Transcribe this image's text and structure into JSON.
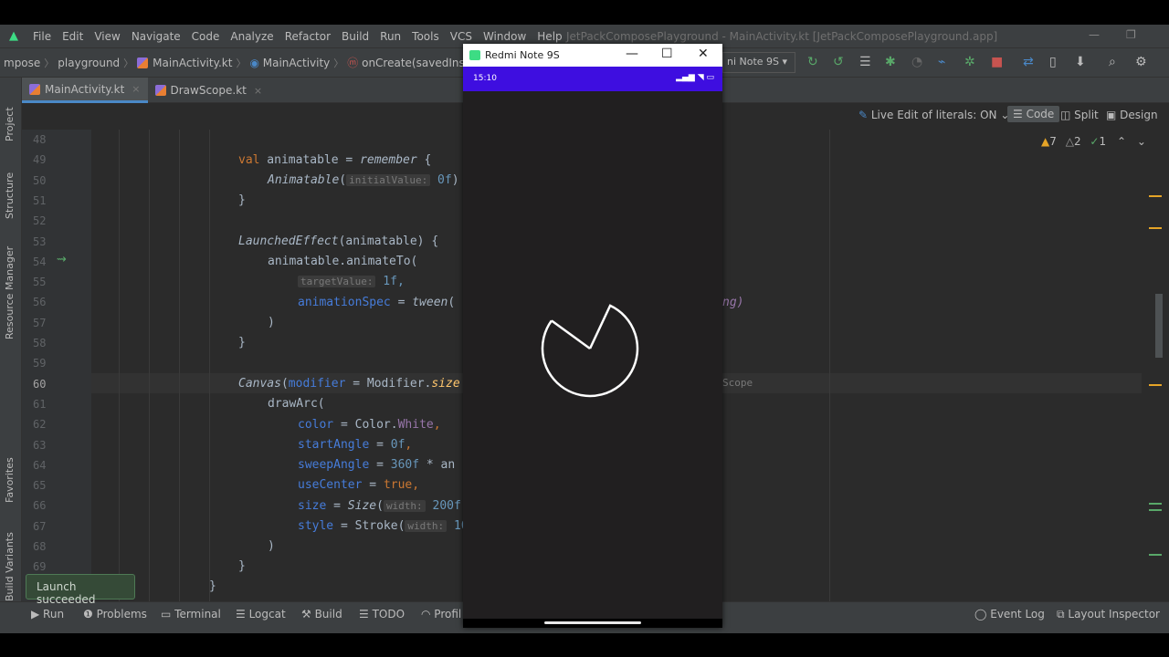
{
  "menu": {
    "items": [
      "File",
      "Edit",
      "View",
      "Navigate",
      "Code",
      "Analyze",
      "Refactor",
      "Build",
      "Run",
      "Tools",
      "VCS",
      "Window",
      "Help"
    ],
    "window_title": "JetPackComposePlayground - MainActivity.kt [JetPackComposePlayground.app]"
  },
  "breadcrumb": [
    "mpose",
    "playground",
    "MainActivity.kt",
    "MainActivity",
    "onCreate(savedInstanceState:"
  ],
  "device_selector": "ni Note 9S",
  "tabs": [
    {
      "label": "MainActivity.kt",
      "close": "×"
    },
    {
      "label": "DrawScope.kt",
      "close": "×"
    }
  ],
  "left_panels": [
    "Project",
    "Structure",
    "Resource Manager",
    "Favorites",
    "Build Variants"
  ],
  "editor_toolbar": {
    "live_edit": "Live Edit of literals: ON",
    "code": "Code",
    "split": "Split",
    "design": "Design"
  },
  "inspections": {
    "warnings": "7",
    "weak_warnings": "2",
    "ok": "1"
  },
  "line_numbers": [
    "48",
    "49",
    "50",
    "51",
    "52",
    "53",
    "54",
    "55",
    "56",
    "57",
    "58",
    "59",
    "60",
    "61",
    "62",
    "63",
    "64",
    "65",
    "66",
    "67",
    "68",
    "69"
  ],
  "current_line": "60",
  "code": {
    "l49": {
      "kw": "val",
      "name": " animatable",
      "eq": " = ",
      "fn": "remember",
      "rest": " {"
    },
    "l50": {
      "fn": "Animatable",
      "open": "(",
      "hint": "initialValue:",
      "val": " 0f",
      "close": ")"
    },
    "l51": "}",
    "l53": {
      "fn": "LaunchedEffect",
      "rest": "(animatable) {"
    },
    "l54": "animatable.animateTo(",
    "l55": {
      "hint": "targetValue:",
      "val": " 1f,"
    },
    "l56": {
      "named": "animationSpec",
      "eq": " = ",
      "fn": "tween",
      "open": "(",
      "tail": "ng)"
    },
    "l57": ")",
    "l58": "}",
    "l60": {
      "fn": "Canvas",
      "open": "(",
      "named": "modifier",
      "eq": " = ",
      "rest": "Modifier.",
      "fn2": "size",
      "tail": "Scope"
    },
    "l61": "drawArc(",
    "l62": {
      "named": "color",
      "eq": " = ",
      "rest": "Color.",
      "prm": "White",
      "end": ","
    },
    "l63": {
      "named": "startAngle",
      "eq": " = ",
      "val": "0f",
      "end": ","
    },
    "l64": {
      "named": "sweepAngle",
      "eq": " = ",
      "val": "360f",
      "rest": " * an"
    },
    "l65": {
      "named": "useCenter",
      "eq": " = ",
      "kw": "true",
      "end": ","
    },
    "l66": {
      "named": "size",
      "eq": " = ",
      "fn": "Size",
      "open": "(",
      "hint": "width:",
      "val": " 200f"
    },
    "l67": {
      "named": "style",
      "eq": " = ",
      "rest": "Stroke(",
      "hint": "width:",
      "val": " 10"
    },
    "l68": ")",
    "l69a": "}",
    "l69b": "}"
  },
  "bottom_bar": [
    "Run",
    "Problems",
    "Terminal",
    "Logcat",
    "Build",
    "TODO",
    "Profil",
    "Event Log",
    "Layout Inspector"
  ],
  "toast": "Launch succeeded",
  "emulator": {
    "title": "Redmi Note 9S",
    "min": "—",
    "max": "☐",
    "close": "✕",
    "time": "15:10",
    "status_icons": "▂▄▆ ◥ ▭",
    "sweep_fraction": 0.78,
    "arc_color": "#ffffff"
  },
  "colors": {
    "accent": "#4a88c7",
    "status_bar": "#3e0ee0",
    "editor_bg": "#2b2b2b"
  }
}
